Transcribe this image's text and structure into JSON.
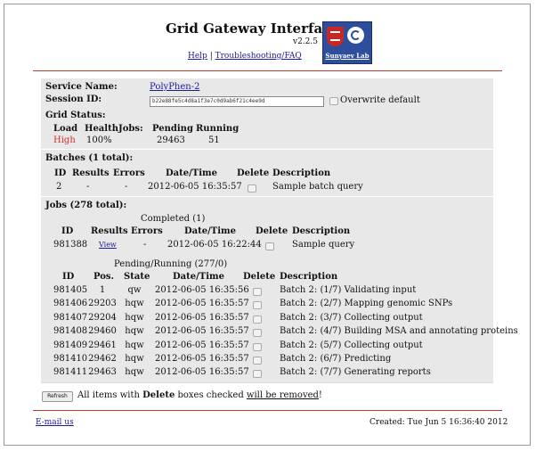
{
  "header": {
    "title": "Grid Gateway Interface",
    "version": "v2.2.5",
    "help_link": "Help",
    "faq_link": "Troubleshooting/FAQ",
    "separator": "|",
    "logo_label": "Sunyaev Lab"
  },
  "service": {
    "name_label": "Service Name:",
    "name_value": "PolyPhen-2",
    "session_label": "Session ID:",
    "session_value": "b22e88fe5c4d8a1f3e7c0d9ab6f21c4ee9d",
    "overwrite_label": "Overwrite default",
    "grid_status_label": "Grid Status:"
  },
  "grid": {
    "headers": [
      "Load",
      "Health",
      "Jobs:",
      "Pending",
      "Running"
    ],
    "load": "High",
    "health": "100%",
    "pending": "29463",
    "running": "51"
  },
  "batches": {
    "title": "Batches (1 total):",
    "headers": [
      "ID",
      "Results",
      "Errors",
      "Date/Time",
      "Delete",
      "Description"
    ],
    "rows": [
      {
        "id": "2",
        "results": "-",
        "errors": "-",
        "datetime": "2012-06-05 16:35:57",
        "description": "Sample batch query"
      }
    ]
  },
  "jobs": {
    "title": "Jobs (278 total):",
    "completed_title": "Completed (1)",
    "completed_headers": [
      "ID",
      "Results",
      "Errors",
      "Date/Time",
      "Delete",
      "Description"
    ],
    "completed_rows": [
      {
        "id": "981388",
        "results": "View",
        "errors": "-",
        "datetime": "2012-06-05 16:22:44",
        "description": "Sample query"
      }
    ],
    "pending_title": "Pending/Running (277/0)",
    "pending_headers": [
      "ID",
      "Pos.",
      "State",
      "Date/Time",
      "Delete",
      "Description"
    ],
    "pending_rows": [
      {
        "id": "981405",
        "pos": "1",
        "state": "qw",
        "datetime": "2012-06-05 16:35:56",
        "description": "Batch 2: (1/7) Validating input"
      },
      {
        "id": "981406",
        "pos": "29203",
        "state": "hqw",
        "datetime": "2012-06-05 16:35:57",
        "description": "Batch 2: (2/7) Mapping genomic SNPs"
      },
      {
        "id": "981407",
        "pos": "29204",
        "state": "hqw",
        "datetime": "2012-06-05 16:35:57",
        "description": "Batch 2: (3/7) Collecting output"
      },
      {
        "id": "981408",
        "pos": "29460",
        "state": "hqw",
        "datetime": "2012-06-05 16:35:57",
        "description": "Batch 2: (4/7) Building MSA and annotating proteins"
      },
      {
        "id": "981409",
        "pos": "29461",
        "state": "hqw",
        "datetime": "2012-06-05 16:35:57",
        "description": "Batch 2: (5/7) Collecting output"
      },
      {
        "id": "981410",
        "pos": "29462",
        "state": "hqw",
        "datetime": "2012-06-05 16:35:57",
        "description": "Batch 2: (6/7) Predicting"
      },
      {
        "id": "981411",
        "pos": "29463",
        "state": "hqw",
        "datetime": "2012-06-05 16:35:57",
        "description": "Batch 2: (7/7) Generating reports"
      }
    ]
  },
  "footer": {
    "refresh_label": "Refresh",
    "note_prefix": "All items with ",
    "note_bold": "Delete",
    "note_mid": " boxes checked ",
    "note_underline": "will be removed",
    "note_suffix": "!",
    "email_link": "E-mail us",
    "created": "Created: Tue Jun 5 16:36:40 2012"
  },
  "colors": {
    "accent_rule": "#c0392b",
    "panel_bg": "#e8e8e8",
    "link": "#1a1a9c",
    "high_load": "#d32f2f"
  }
}
